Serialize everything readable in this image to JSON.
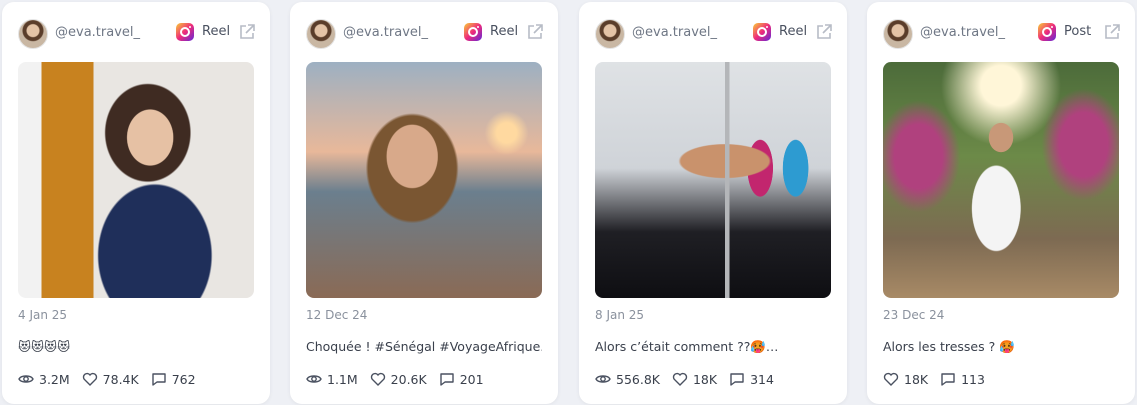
{
  "cards": [
    {
      "handle": "@eva.travel_",
      "platform_icon": "instagram-icon",
      "post_type": "Reel",
      "date": "4 Jan 25",
      "caption": "😻😻😻😻",
      "views": "3.2M",
      "likes": "78.4K",
      "comments": "762"
    },
    {
      "handle": "@eva.travel_",
      "platform_icon": "instagram-icon",
      "post_type": "Reel",
      "date": "12 Dec 24",
      "caption": "Choquée ! #Sénégal #VoyageAfrique…",
      "views": "1.1M",
      "likes": "20.6K",
      "comments": "201"
    },
    {
      "handle": "@eva.travel_",
      "platform_icon": "instagram-icon",
      "post_type": "Reel",
      "date": "8 Jan 25",
      "caption": "Alors c’était comment ??🥵…",
      "views": "556.8K",
      "likes": "18K",
      "comments": "314"
    },
    {
      "handle": "@eva.travel_",
      "platform_icon": "instagram-icon",
      "post_type": "Post",
      "date": "23 Dec 24",
      "caption": "Alors les tresses ? 🥵",
      "likes": "18K",
      "comments": "113"
    }
  ]
}
